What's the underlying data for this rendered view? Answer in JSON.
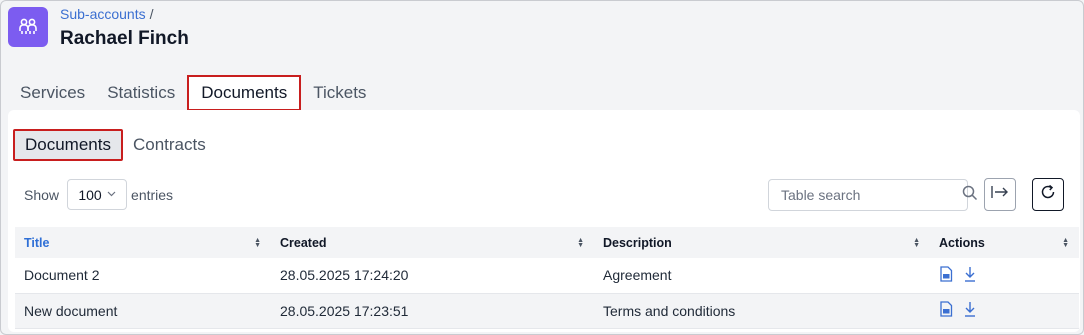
{
  "header": {
    "breadcrumb": "Sub-accounts",
    "breadcrumb_sep": "/",
    "title": "Rachael Finch",
    "avatar_icon": "sub-accounts-icon",
    "accent": "#7c5cf0"
  },
  "tabs": [
    {
      "label": "Services"
    },
    {
      "label": "Statistics"
    },
    {
      "label": "Documents",
      "active": true
    },
    {
      "label": "Tickets"
    }
  ],
  "subtabs": [
    {
      "label": "Documents",
      "active": true
    },
    {
      "label": "Contracts"
    }
  ],
  "table_controls": {
    "show_label": "Show",
    "entries_value": "100",
    "entries_label": "entries",
    "search_placeholder": "Table search",
    "export_icon": "export-icon",
    "refresh_icon": "refresh-icon"
  },
  "table": {
    "columns": [
      "Title",
      "Created",
      "Description",
      "Actions"
    ],
    "rows": [
      {
        "title": "Document 2",
        "created": "28.05.2025 17:24:20",
        "description": "Agreement"
      },
      {
        "title": "New document",
        "created": "28.05.2025 17:23:51",
        "description": "Terms and conditions"
      }
    ]
  },
  "colors": {
    "highlight_border": "#c81e1e",
    "link": "#3b6fd1"
  }
}
